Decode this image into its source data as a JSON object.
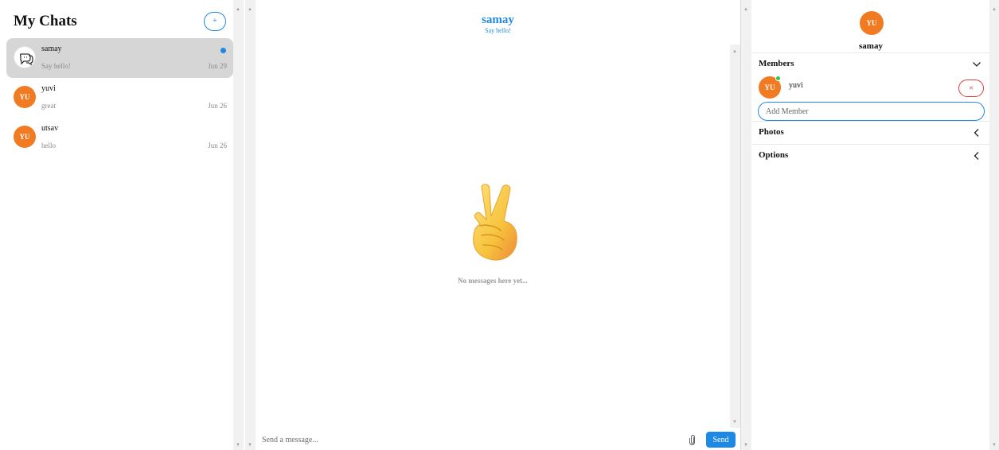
{
  "sidebar": {
    "title": "My Chats",
    "new_chat_label": "+",
    "chats": [
      {
        "name": "samay",
        "preview": "Say hello!",
        "date": "Jun 29",
        "avatar": "group-chat-icon",
        "unread": true,
        "active": true
      },
      {
        "name": "yuvi",
        "preview": "great",
        "date": "Jun 26",
        "initials": "YU"
      },
      {
        "name": "utsav",
        "preview": "hello",
        "date": "Jun 26",
        "initials": "YU"
      }
    ]
  },
  "chat": {
    "name": "samay",
    "status": "Say hello!",
    "empty_icon": "victory-hand-emoji",
    "empty_text": "No messages here yet...",
    "input_placeholder": "Send a message...",
    "send_label": "Send",
    "attach_icon": "paperclip-icon"
  },
  "details": {
    "initials": "YU",
    "name": "samay",
    "members_label": "Members",
    "members": [
      {
        "initials": "YU",
        "name": "yuvi",
        "online": true
      }
    ],
    "remove_label": "×",
    "add_member_placeholder": "Add Member",
    "photos_label": "Photos",
    "options_label": "Options"
  },
  "colors": {
    "accent": "#1e88e5",
    "avatar": "#f07b22",
    "danger": "#e53935",
    "online": "#2ecc40"
  }
}
